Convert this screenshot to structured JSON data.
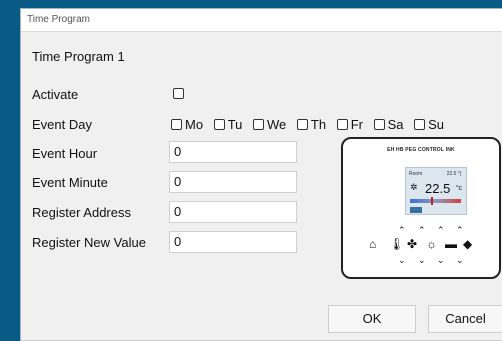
{
  "window": {
    "title": "Time Program"
  },
  "heading": "Time Program 1",
  "labels": {
    "activate": "Activate",
    "event_day": "Event Day",
    "event_hour": "Event Hour",
    "event_minute": "Event Minute",
    "register_address": "Register Address",
    "register_new_value": "Register New Value"
  },
  "days": [
    "Mo",
    "Tu",
    "We",
    "Th",
    "Fr",
    "Sa",
    "Su"
  ],
  "fields": {
    "event_hour": "0",
    "event_minute": "0",
    "register_address": "0",
    "register_new_value": "0"
  },
  "device": {
    "brand": "EH HB PEG CONTROL INK",
    "screen_left": "Room",
    "screen_right": "22.5 °|",
    "temperature": "22.5",
    "unit": "°c"
  },
  "buttons": {
    "ok": "OK",
    "cancel": "Cancel"
  }
}
